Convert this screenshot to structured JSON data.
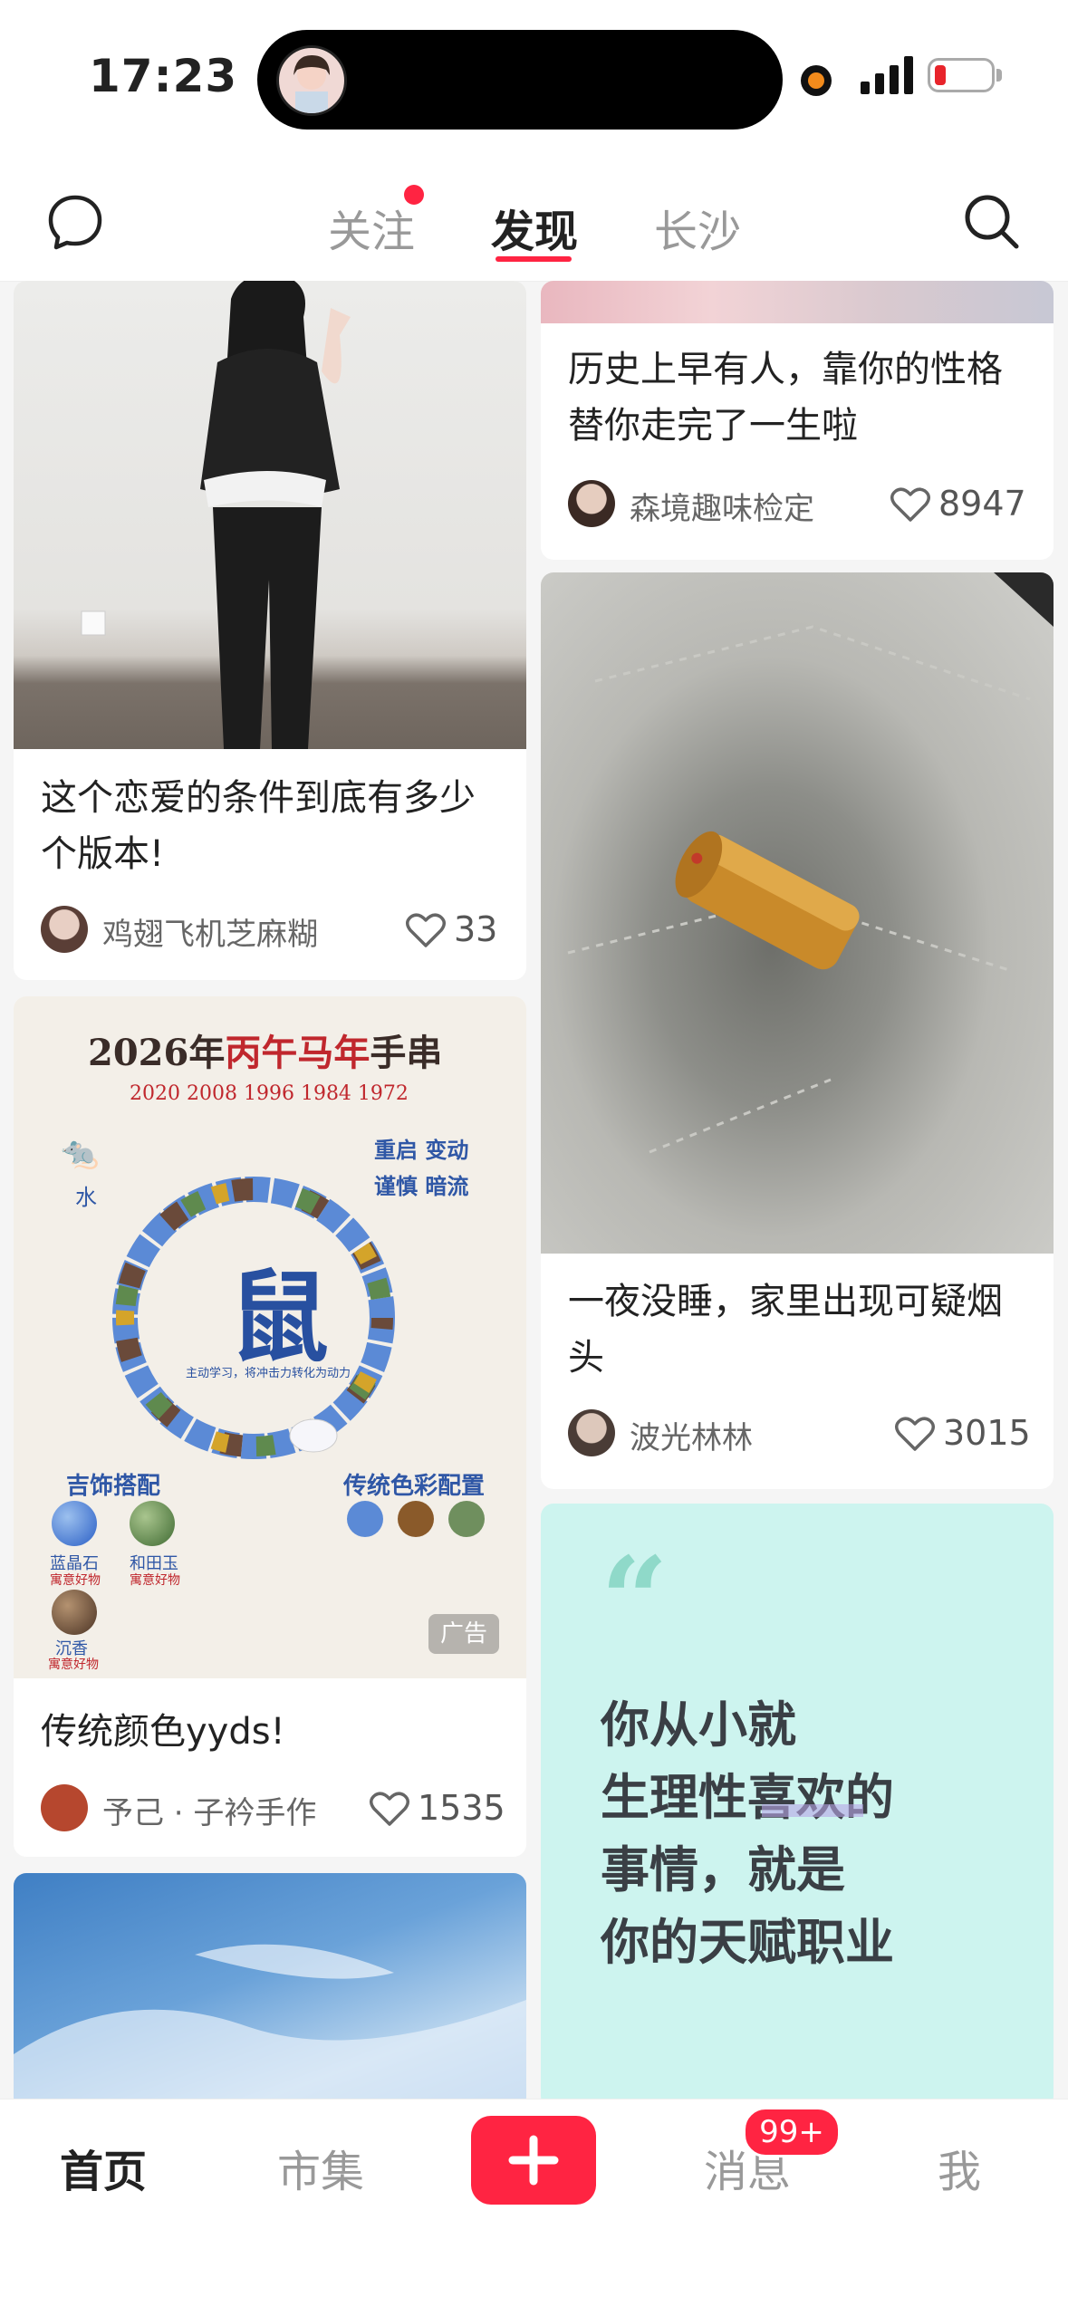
{
  "status_bar": {
    "time": "17:23"
  },
  "top_tabs": {
    "follow": "关注",
    "discover": "发现",
    "city": "长沙"
  },
  "cards": {
    "c1": {
      "title": "这个恋爱的条件到底有多少个版本!",
      "author": "鸡翅飞机芝麻糊",
      "likes": "33"
    },
    "c2": {
      "title": "传统颜色yyds!",
      "author": "予己 · 子衿手作",
      "likes": "1535",
      "ad_label": "广告"
    },
    "c3": {
      "title": "历史上早有人，靠你的性格替你走完了一生啦",
      "author": "森境趣味检定",
      "likes": "8947"
    },
    "c4": {
      "title": "一夜没睡，家里出现可疑烟头",
      "author": "波光林林",
      "likes": "3015"
    },
    "c5": {
      "quote_lines": [
        "你从小就",
        "生理性喜欢的",
        "事情，就是",
        "你的天赋职业"
      ]
    }
  },
  "ad_image": {
    "year_a": "2026年",
    "year_b": "丙午马年",
    "year_c": "手串",
    "years": "2020 2008 1996 1984 1972",
    "zodiac": "鼠",
    "element": "水",
    "tag_a": "重启  变动",
    "tag_b": "谨慎  暗流",
    "caption": "主动学习，将冲击力转化为动力",
    "left_title": "吉饰搭配",
    "right_title": "传统色彩配置",
    "stone_1": "蓝晶石",
    "stone_2": "和田玉",
    "stone_3": "沉香",
    "stone_sub": "寓意好物"
  },
  "bottom_nav": {
    "home": "首页",
    "market": "市集",
    "messages": "消息",
    "me": "我",
    "badge": "99+"
  },
  "colors": {
    "accent": "#ff2442"
  }
}
